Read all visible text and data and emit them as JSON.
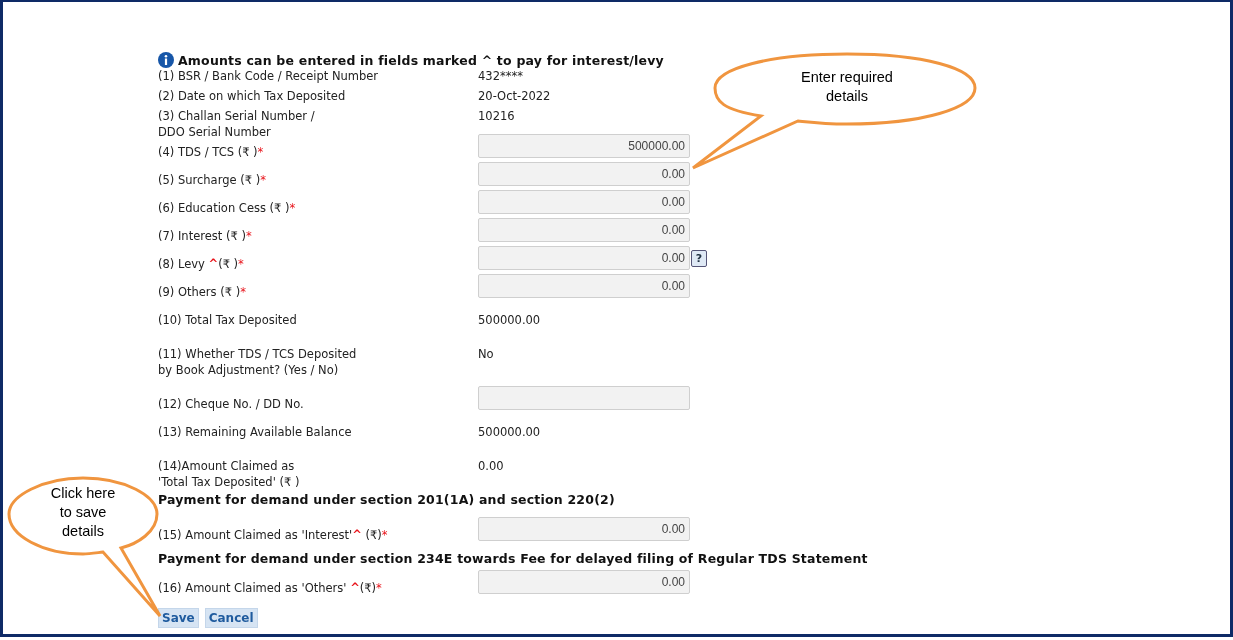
{
  "notice": "Amounts can be entered in fields marked ^ to pay for interest/levy",
  "details": [
    {
      "label": "(1) BSR / Bank Code / Receipt Number",
      "value": "432****"
    },
    {
      "label": "(2) Date on which Tax Deposited",
      "value": "20-Oct-2022"
    },
    {
      "label": "(3) Challan Serial Number /\nDDO Serial Number",
      "value": "10216"
    }
  ],
  "sections": [
    {
      "rows": [
        {
          "kind": "input",
          "label": "(4) TDS / TCS (₹ )",
          "required_mark": "*",
          "value": "500000.00"
        },
        {
          "kind": "input",
          "label": "(5) Surcharge (₹ )",
          "required_mark": "*",
          "value": "0.00"
        },
        {
          "kind": "input",
          "label": "(6) Education Cess (₹ )",
          "required_mark": "*",
          "value": "0.00"
        },
        {
          "kind": "input",
          "label": "(7) Interest (₹ )",
          "required_mark": "*",
          "value": "0.00"
        },
        {
          "kind": "input",
          "label": "(8) Levy ",
          "caret": "^",
          "label_after": "(₹ )",
          "required_mark": "*",
          "value": "0.00",
          "help": "?"
        },
        {
          "kind": "input",
          "label": "(9) Others (₹ )",
          "required_mark": "*",
          "value": "0.00"
        },
        {
          "kind": "text",
          "label": "(10) Total Tax Deposited",
          "value": "500000.00"
        },
        {
          "kind": "text",
          "label": "(11) Whether TDS / TCS Deposited\nby Book Adjustment? (Yes / No)",
          "value": "No"
        },
        {
          "kind": "input",
          "label": "(12) Cheque No. / DD No."
        },
        {
          "kind": "text",
          "label": "(13) Remaining Available Balance",
          "value": "500000.00"
        },
        {
          "kind": "text",
          "label": "(14)Amount Claimed as\n'Total Tax Deposited' (₹ )",
          "value": "0.00"
        }
      ]
    },
    {
      "heading": "Payment for demand under section 201(1A) and section 220(2)",
      "rows": [
        {
          "kind": "input",
          "label": "(15) Amount Claimed as 'Interest'",
          "caret": "^",
          "label_after": " (₹)",
          "required_mark": "*",
          "value": "0.00"
        }
      ]
    },
    {
      "heading": "Payment for demand under section 234E towards Fee for delayed filing of Regular TDS Statement",
      "rows": [
        {
          "kind": "input",
          "label": "(16) Amount Claimed as 'Others' ",
          "caret": "^",
          "label_after": "(₹)",
          "required_mark": "*",
          "value": "0.00"
        }
      ]
    }
  ],
  "buttons": [
    "Save",
    "Cancel"
  ],
  "callouts": [
    {
      "kind": "top",
      "text": "Enter required\ndetails"
    },
    {
      "kind": "bottom",
      "text": "Click here\nto save\ndetails"
    }
  ]
}
